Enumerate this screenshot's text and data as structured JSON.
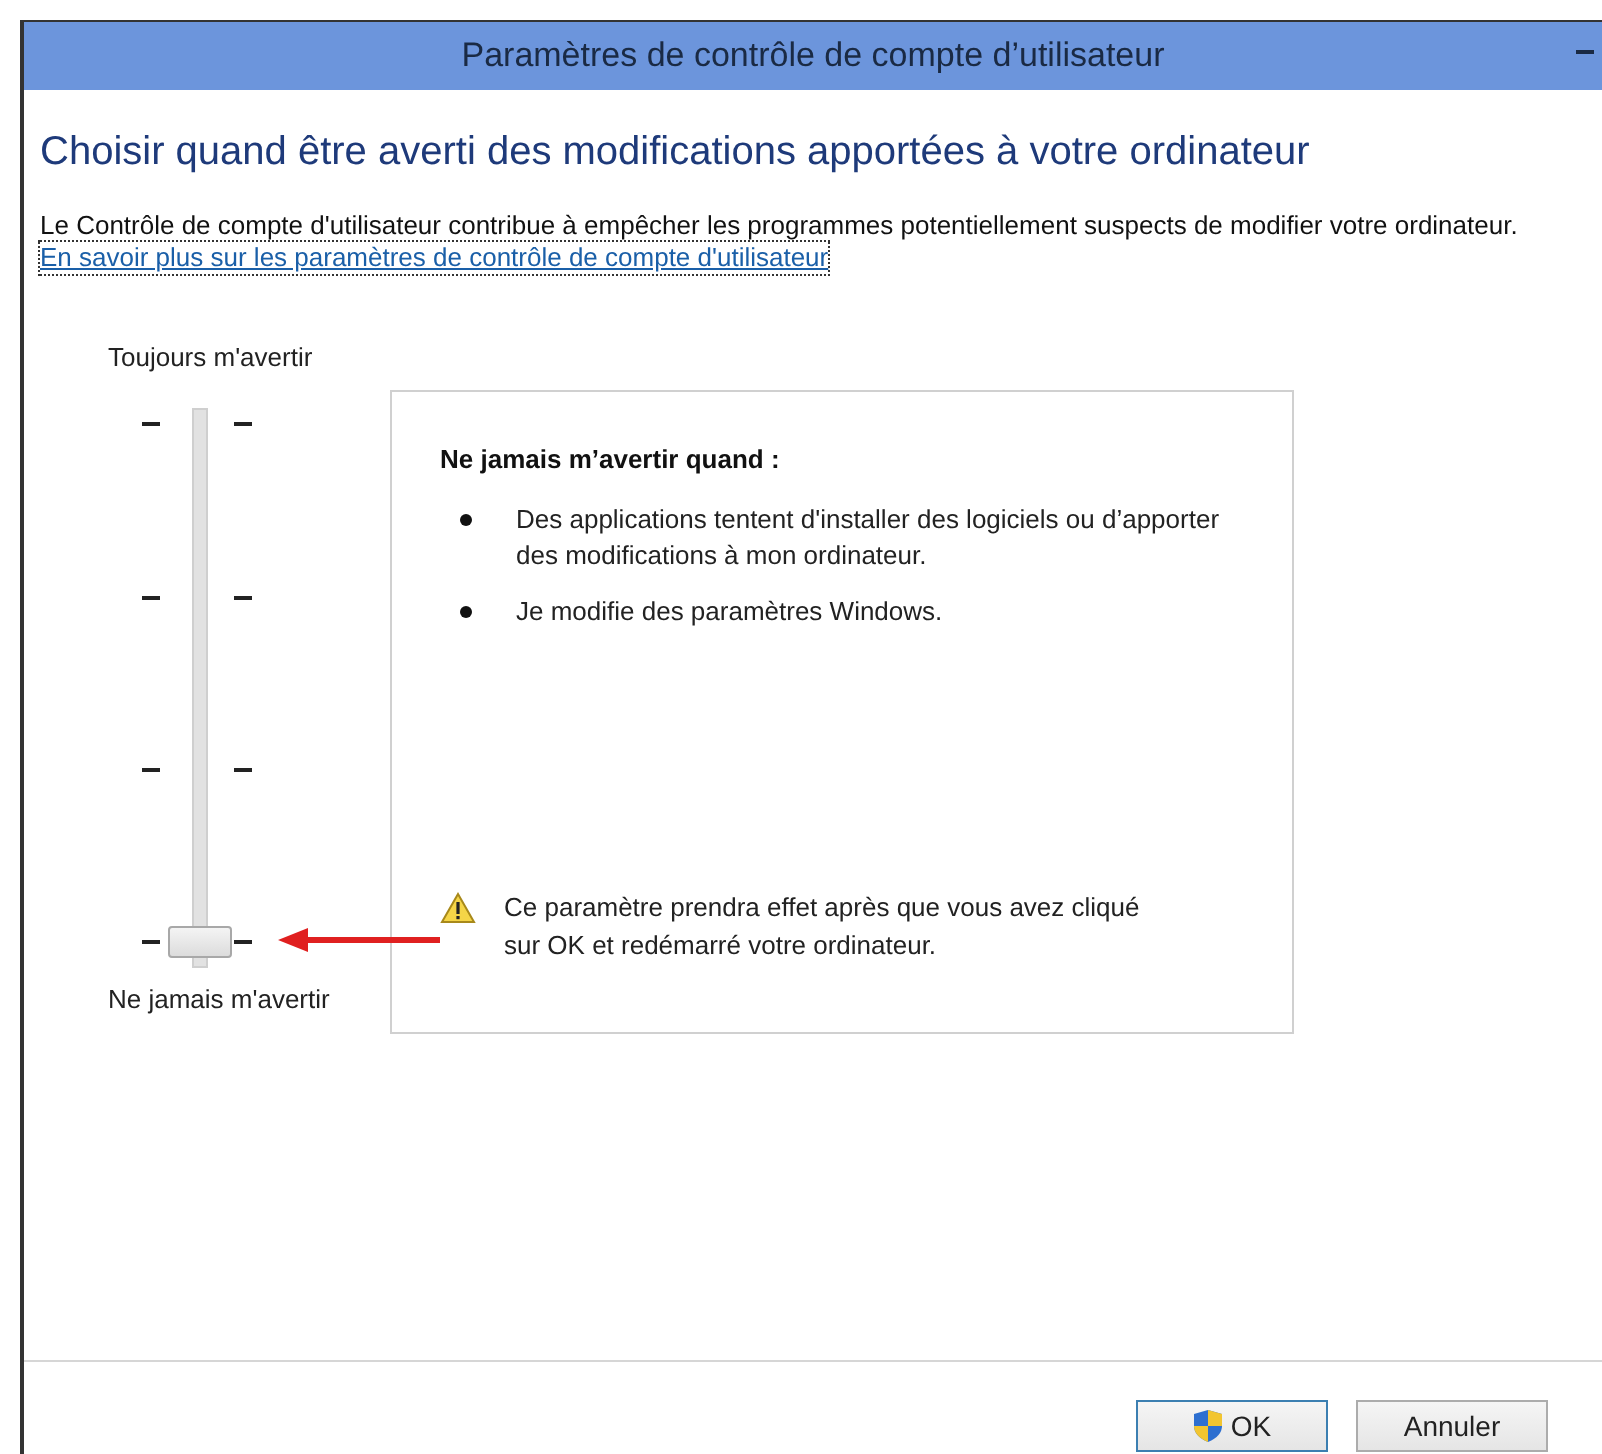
{
  "window": {
    "title": "Paramètres de contrôle de compte d’utilisateur"
  },
  "heading": "Choisir quand être averti des modifications apportées à votre ordinateur",
  "description": "Le Contrôle de compte d'utilisateur contribue à empêcher les programmes potentiellement suspects de modifier votre ordinateur.",
  "link": "En savoir plus sur les paramètres de contrôle de compte d'utilisateur",
  "slider": {
    "top_label": "Toujours m'avertir",
    "bottom_label": "Ne jamais m'avertir",
    "level": 0
  },
  "info": {
    "title": "Ne jamais m’avertir quand :",
    "bullets": [
      "Des applications tentent d'installer des logiciels ou d’apporter des modifications à mon ordinateur.",
      "Je modifie des paramètres Windows."
    ],
    "warning": "Ce paramètre prendra effet après que vous avez cliqué sur OK et redémarré votre ordinateur."
  },
  "buttons": [
    {
      "label": "OK",
      "kind": "shield"
    },
    {
      "label": "Annuler",
      "kind": "plain"
    }
  ]
}
